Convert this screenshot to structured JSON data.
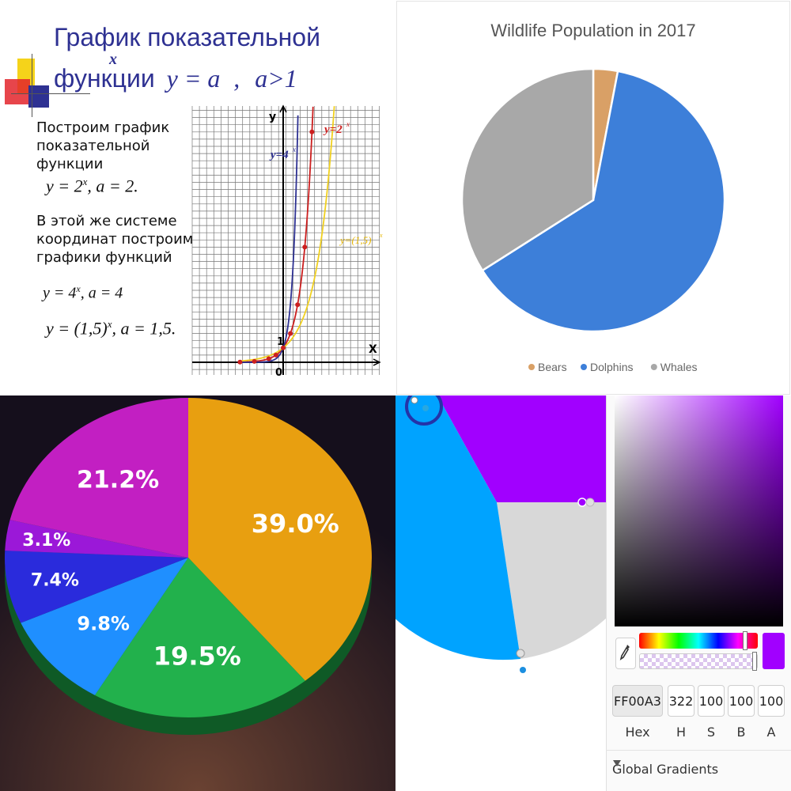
{
  "slide": {
    "title_line1": "График показательной",
    "title_line2": "функции",
    "title_formula": "y = a",
    "title_exponent": "x",
    "title_condition": "a>1",
    "para1_l1": "Построим график",
    "para1_l2": "показательной",
    "para1_l3": "функции",
    "formula1": "y = 2",
    "formula1_exp": "x",
    "formula1_tail": ", a = 2.",
    "para2_l1": "В этой же системе",
    "para2_l2": "координат построим",
    "para2_l3": "графики функций",
    "formula2": "y = 4",
    "formula2_exp": "x",
    "formula2_tail": ", a = 4",
    "formula3": "y = (1,5)",
    "formula3_exp": "x",
    "formula3_tail": ", a = 1,5.",
    "axis_y": "y",
    "axis_x": "X",
    "origin": "0",
    "one": "1",
    "curve_label_2": "y=2",
    "curve_label_4": "y=4",
    "curve_label_15": "y=(1,5)",
    "curve_label_exp": "x",
    "colors": {
      "title": "#2e3192",
      "curve_2": "#cc1f1f",
      "curve_4": "#2e3192",
      "curve_15": "#f0d020"
    }
  },
  "chart_data": [
    {
      "type": "line",
      "title": "",
      "series": [
        {
          "name": "y=2^x",
          "color": "#cc1f1f",
          "x": [
            -6,
            -4,
            -2,
            -1,
            0,
            1,
            2,
            3,
            4
          ],
          "y": [
            0.016,
            0.063,
            0.25,
            0.5,
            1,
            2,
            4,
            8,
            16
          ]
        },
        {
          "name": "y=4^x",
          "color": "#2e3192",
          "x": [
            -3,
            -2,
            -1,
            0,
            1,
            2
          ],
          "y": [
            0.016,
            0.063,
            0.25,
            1,
            4,
            16
          ]
        },
        {
          "name": "y=(1,5)^x",
          "color": "#f0d020",
          "x": [
            -6,
            -4,
            -2,
            0,
            2,
            4,
            6,
            8
          ],
          "y": [
            0.088,
            0.198,
            0.444,
            1,
            2.25,
            5.06,
            11.39,
            25.6
          ]
        }
      ],
      "xlim": [
        -6,
        6
      ],
      "ylim": [
        -1,
        17
      ],
      "grid": true,
      "marked_points": [
        [
          -6,
          0.016
        ],
        [
          -4,
          0.063
        ],
        [
          -2,
          0.25
        ],
        [
          -1,
          0.5
        ],
        [
          0,
          1
        ],
        [
          1,
          2
        ],
        [
          2,
          4
        ],
        [
          3,
          8
        ],
        [
          4,
          16
        ]
      ]
    },
    {
      "type": "pie",
      "title": "Wildlife Population in 2017",
      "categories": [
        "Bears",
        "Dolphins",
        "Whales"
      ],
      "values": [
        3,
        63,
        34
      ],
      "colors": [
        "#d9a066",
        "#3d7fd9",
        "#a8a8a8"
      ],
      "legend": "bottom"
    },
    {
      "type": "pie",
      "title": "",
      "labels": [
        "39.0%",
        "19.5%",
        "9.8%",
        "7.4%",
        "3.1%",
        "21.2%"
      ],
      "values": [
        39.0,
        19.5,
        9.8,
        7.4,
        3.1,
        21.2
      ],
      "colors": [
        "#e89f10",
        "#22b14c",
        "#1f8fff",
        "#2a2bdc",
        "#9b18d8",
        "#c21fc2"
      ]
    }
  ],
  "editor": {
    "pie_colors": [
      "#a100ff",
      "#d8d8d8",
      "#00a3ff"
    ],
    "hex_value": "FF00A3",
    "h_value": "322",
    "s_value": "100",
    "b_value": "100",
    "a_value": "100",
    "hex_label": "Hex",
    "h_label": "H",
    "s_label": "S",
    "b_label": "B",
    "a_label": "A",
    "section_label": "Global Gradients",
    "picker_hue": "#a100ff",
    "swatch_color": "#a100ff",
    "eyedropper_icon": "eyedropper-icon",
    "triangle_icon": "triangle-down-icon"
  }
}
